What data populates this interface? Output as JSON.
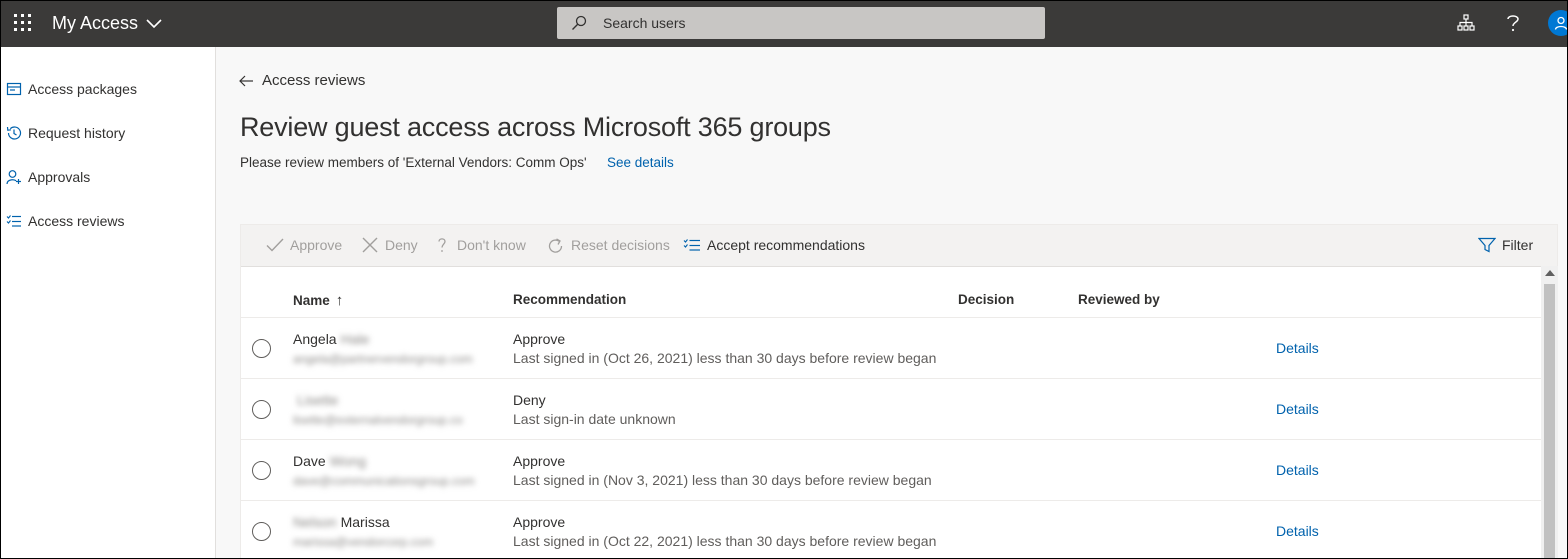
{
  "topbar": {
    "app_title": "My Access",
    "search_placeholder": "Search users"
  },
  "sidebar": {
    "items": [
      {
        "label": "Access packages",
        "icon": "package-icon"
      },
      {
        "label": "Request history",
        "icon": "history-icon"
      },
      {
        "label": "Approvals",
        "icon": "person-add-icon"
      },
      {
        "label": "Access reviews",
        "icon": "checklist-icon"
      }
    ]
  },
  "main": {
    "back_label": "Access reviews",
    "title": "Review guest access across Microsoft 365 groups",
    "subtitle": "Please review members of 'External Vendors: Comm Ops'",
    "see_details": "See details"
  },
  "toolbar": {
    "approve": "Approve",
    "deny": "Deny",
    "dont_know": "Don't know",
    "reset": "Reset decisions",
    "accept": "Accept recommendations",
    "filter": "Filter"
  },
  "table": {
    "columns": {
      "name": "Name",
      "recommendation": "Recommendation",
      "decision": "Decision",
      "reviewed_by": "Reviewed by"
    },
    "sort_indicator": "↑",
    "rows": [
      {
        "first": "Angela",
        "last_blurred": "Hale",
        "email_blurred": "angela@partnervendorgroup.com",
        "recommendation": "Approve",
        "reason": "Last signed in (Oct 26, 2021) less than 30 days before review began",
        "details": "Details"
      },
      {
        "first": "",
        "last_blurred": "Lisette",
        "email_blurred": "lisette@externalvendorgroup.co",
        "recommendation": "Deny",
        "reason": "Last sign-in date unknown",
        "details": "Details"
      },
      {
        "first": "Dave",
        "last_blurred": "Wong",
        "email_blurred": "dave@communicationsgroup.com",
        "recommendation": "Approve",
        "reason": "Last signed in (Nov 3, 2021) less than 30 days before review began",
        "details": "Details"
      },
      {
        "first": "Marissa",
        "last_blurred": "Nelson",
        "email_blurred": "marissa@vendorcorp.com",
        "recommendation": "Approve",
        "reason": "Last signed in (Oct 22, 2021) less than 30 days before review began",
        "details": "Details"
      }
    ]
  }
}
